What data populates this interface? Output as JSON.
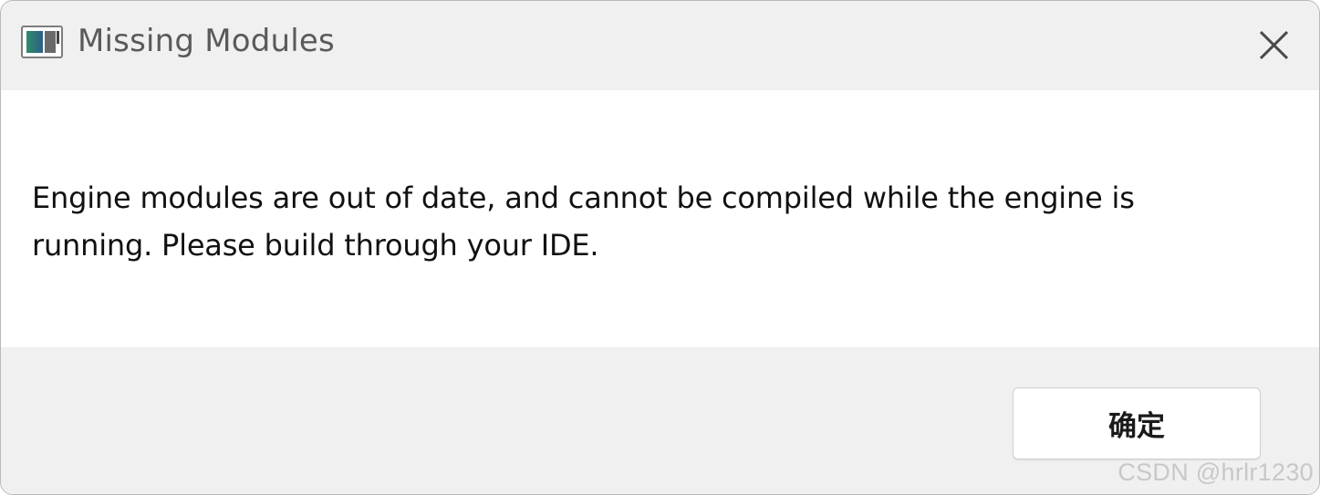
{
  "window": {
    "title": "Missing Modules",
    "icon": "app-window-icon",
    "close_icon": "close-icon"
  },
  "dialog": {
    "message": "Engine modules are out of date, and cannot be compiled while the engine is running. Please build through your IDE.",
    "ok_label": "确定"
  },
  "watermark": {
    "text": "CSDN @hrlr1230"
  },
  "colors": {
    "titlebar_bg": "#f0f0f0",
    "content_bg": "#ffffff",
    "footer_bg": "#f0f0f0",
    "button_bg": "#ffffff"
  }
}
